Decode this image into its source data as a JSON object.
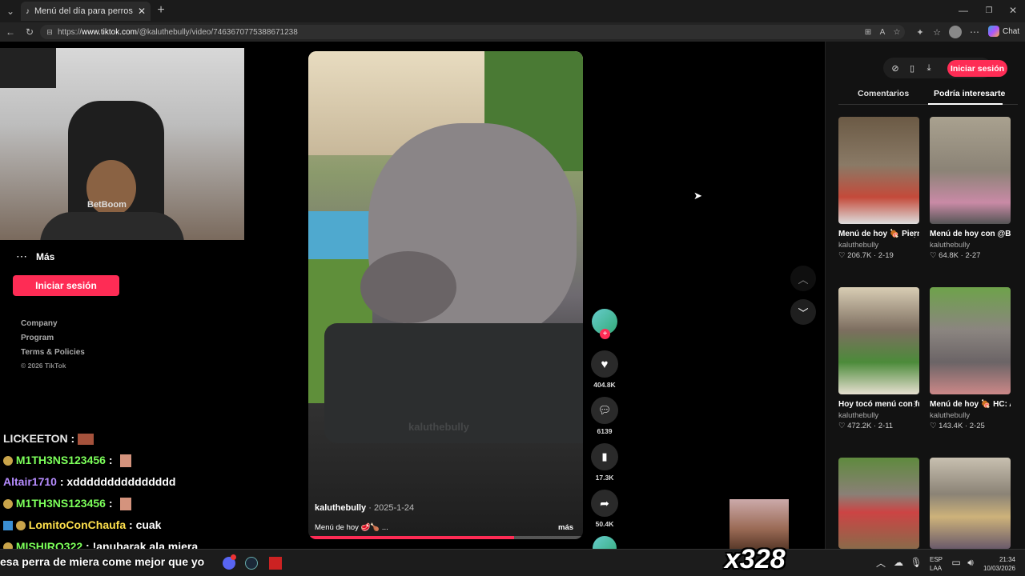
{
  "browser": {
    "tab_title": "Menú del día para perros: die",
    "url_prefix": "https://",
    "url_domain": "www.tiktok.com",
    "url_path": "/@kaluthebully/video/7463670775388671238",
    "chat_label": "Chat"
  },
  "sidebar": {
    "more_label": "Más",
    "login_label": "Iniciar sesión",
    "links": [
      "Company",
      "Program",
      "Terms & Policies"
    ],
    "copyright": "© 2026 TikTok"
  },
  "webcam": {
    "shirt_text": "BetBoom"
  },
  "video": {
    "author": "kaluthebully",
    "date": "· 2025-1-24",
    "caption": "Menú de hoy 🥩🍗 ...",
    "more": "más",
    "watermark": "kaluthebully",
    "progress": 0.75,
    "likes": "404.8K",
    "comments": "6139",
    "saves": "17.3K",
    "shares": "50.4K"
  },
  "right_panel": {
    "login_label": "Iniciar sesión",
    "tabs": [
      "Comentarios",
      "Podría interesarte"
    ],
    "active_tab": 1,
    "cards": [
      {
        "title": "Menú de hoy 🍖 Pierna de poll...",
        "author": "kaluthebully",
        "likes": "206.7K",
        "date": "2-19"
      },
      {
        "title": "Menú de hoy con @Barfi 🩷 La...",
        "author": "kaluthebully",
        "likes": "64.8K",
        "date": "2-27"
      },
      {
        "title": "Hoy tocó menú con full insumos...",
        "author": "kaluthebully",
        "likes": "472.2K",
        "date": "2-11"
      },
      {
        "title": "Menú de hoy 🍖 HC: Alita de poll...",
        "author": "kaluthebully",
        "likes": "143.4K",
        "date": "2-25"
      },
      {
        "title": "",
        "author": "",
        "likes": "",
        "date": ""
      },
      {
        "title": "",
        "author": "",
        "likes": "",
        "date": ""
      }
    ]
  },
  "chat": [
    {
      "user": "LICKEETON",
      "msg": "",
      "color": "#e8e8e8"
    },
    {
      "user": "M1TH3NS123456",
      "msg": "",
      "color": "#7cff5a"
    },
    {
      "user": "Altair1710",
      "msg": "xddddddddddddddd",
      "color": "#b68cff"
    },
    {
      "user": "M1TH3NS123456",
      "msg": "",
      "color": "#7cff5a"
    },
    {
      "user": "LomitoConChaufa",
      "msg": "cuak",
      "color": "#ffe14d"
    },
    {
      "user": "MISHIRO322",
      "msg": "!anubarak ala miera",
      "color": "#7cff5a"
    }
  ],
  "ticker": "esa perra de miera come mejor que yo",
  "emote_counter": "x328",
  "taskbar": {
    "lang1": "ESP",
    "lang2": "LAA",
    "time": "21:34",
    "date": "10/03/2026"
  },
  "colors": {
    "accent": "#fe2c55",
    "background": "#000000",
    "panel": "#121212"
  }
}
